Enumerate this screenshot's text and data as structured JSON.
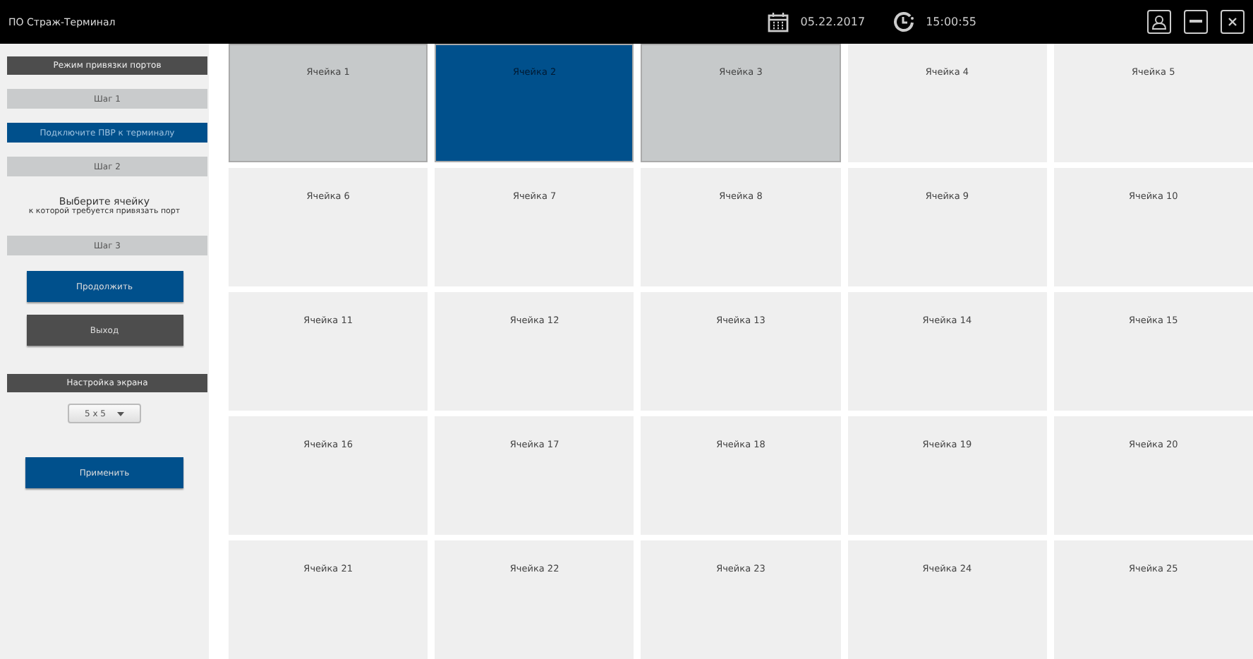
{
  "window": {
    "title": "ПО Страж-Терминал",
    "date": "05.22.2017",
    "time": "15:00:55"
  },
  "sidebar": {
    "mode_header": "Режим привязки портов",
    "steps": [
      {
        "kind": "step",
        "text": "Шаг 1"
      },
      {
        "kind": "banner",
        "text": "Подключите ПВР к терминалу"
      },
      {
        "kind": "step",
        "text": "Шаг 2"
      },
      {
        "kind": "note",
        "text": "Выберите ячейку",
        "subtext": "к которой требуется привязать порт"
      },
      {
        "kind": "step",
        "text": "Шаг 3"
      }
    ],
    "continue_button": "Продолжить",
    "exit_button": "Выход",
    "screen_header": "Настройка экрана",
    "grid_select": {
      "value": "5 x 5"
    },
    "apply_button": "Применить"
  },
  "cells": [
    {
      "label": "Ячейка 1",
      "selected": false,
      "occupied": true
    },
    {
      "label": "Ячейка 2",
      "selected": true,
      "occupied": false
    },
    {
      "label": "Ячейка 3",
      "selected": false,
      "occupied": true
    },
    {
      "label": "Ячейка 4",
      "selected": false,
      "occupied": false
    },
    {
      "label": "Ячейка 5",
      "selected": false,
      "occupied": false
    },
    {
      "label": "Ячейка 6",
      "selected": false,
      "occupied": false
    },
    {
      "label": "Ячейка 7",
      "selected": false,
      "occupied": false
    },
    {
      "label": "Ячейка 8",
      "selected": false,
      "occupied": false
    },
    {
      "label": "Ячейка 9",
      "selected": false,
      "occupied": false
    },
    {
      "label": "Ячейка 10",
      "selected": false,
      "occupied": false
    },
    {
      "label": "Ячейка 11",
      "selected": false,
      "occupied": false
    },
    {
      "label": "Ячейка 12",
      "selected": false,
      "occupied": false
    },
    {
      "label": "Ячейка 13",
      "selected": false,
      "occupied": false
    },
    {
      "label": "Ячейка 14",
      "selected": false,
      "occupied": false
    },
    {
      "label": "Ячейка 15",
      "selected": false,
      "occupied": false
    },
    {
      "label": "Ячейка 16",
      "selected": false,
      "occupied": false
    },
    {
      "label": "Ячейка 17",
      "selected": false,
      "occupied": false
    },
    {
      "label": "Ячейка 18",
      "selected": false,
      "occupied": false
    },
    {
      "label": "Ячейка 19",
      "selected": false,
      "occupied": false
    },
    {
      "label": "Ячейка 20",
      "selected": false,
      "occupied": false
    },
    {
      "label": "Ячейка 21",
      "selected": false,
      "occupied": false
    },
    {
      "label": "Ячейка 22",
      "selected": false,
      "occupied": false
    },
    {
      "label": "Ячейка 23",
      "selected": false,
      "occupied": false
    },
    {
      "label": "Ячейка 24",
      "selected": false,
      "occupied": false
    },
    {
      "label": "Ячейка 25",
      "selected": false,
      "occupied": false
    }
  ]
}
